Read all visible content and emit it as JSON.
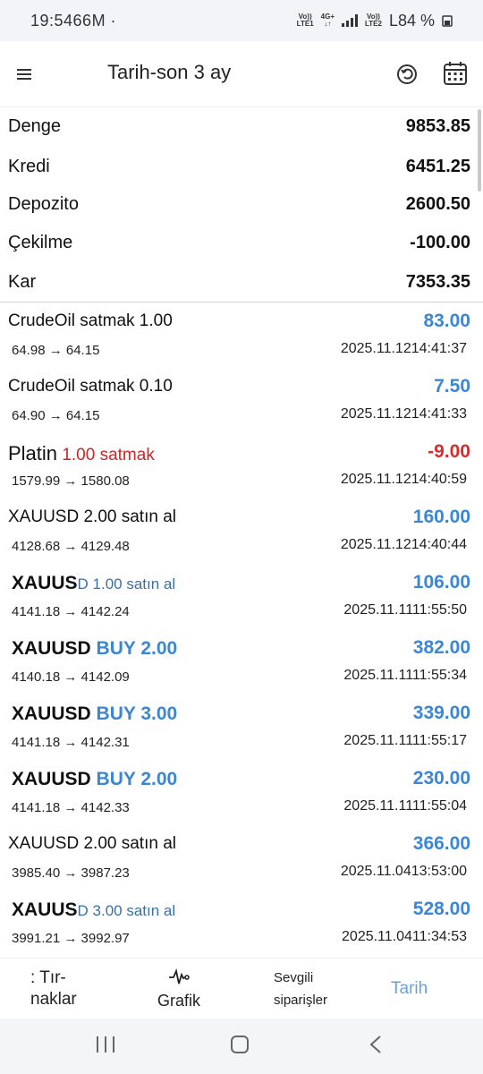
{
  "status_bar": {
    "time": "19:5466M ·",
    "net1_top": "Vo))",
    "net1_bottom": "LTE1",
    "net_mid_top": "4G+",
    "net_mid_bottom": "↓↑",
    "net2_top": "Vo))",
    "net2_bottom": "LTE2",
    "battery": "L84 %"
  },
  "app_bar": {
    "title": "Tarih-son 3 ay"
  },
  "summary": [
    {
      "label": "Denge",
      "value": "9853.85"
    },
    {
      "label": "Kredi",
      "value": "6451.25"
    },
    {
      "label": "Depozito",
      "value": "2600.50"
    },
    {
      "label": "Çekilme",
      "value": "-100.00"
    },
    {
      "label": "Kar",
      "value": "7353.35"
    }
  ],
  "trades": [
    {
      "symbol": "CrudeOil",
      "action": "satmak 1.00",
      "profit": "83.00",
      "prices": "64.98 → 64.15",
      "time": "2025.11.1214:41:37"
    },
    {
      "symbol": "CrudeOil",
      "action": "satmak 0.10",
      "profit": "7.50",
      "prices": "64.90 → 64.15",
      "time": "2025.11.1214:41:33"
    },
    {
      "symbol": "Platin",
      "action": "1.00 satmak",
      "profit": "-9.00",
      "prices": "1579.99 → 1580.08",
      "time": "2025.11.1214:40:59"
    },
    {
      "symbol": "XAUUSD",
      "action": "2.00 satın al",
      "profit": "160.00",
      "prices": "4128.68 → 4129.48",
      "time": "2025.11.1214:40:44"
    },
    {
      "symbol": "XAUUS",
      "action": "D 1.00 satın al",
      "profit": "106.00",
      "prices": "4141.18 → 4142.24",
      "time": "2025.11.1111:55:50"
    },
    {
      "symbol": "XAUUSD",
      "action": "BUY 2.00",
      "profit": "382.00",
      "prices": "4140.18 → 4142.09",
      "time": "2025.11.1111:55:34"
    },
    {
      "symbol": "XAUUSD",
      "action": "BUY 3.00",
      "profit": "339.00",
      "prices": "4141.18 → 4142.31",
      "time": "2025.11.1111:55:17"
    },
    {
      "symbol": "XAUUSD",
      "action": "BUY 2.00",
      "profit": "230.00",
      "prices": "4141.18 → 4142.33",
      "time": "2025.11.1111:55:04"
    },
    {
      "symbol": "XAUUSD",
      "action": "2.00 satın al",
      "profit": "366.00",
      "prices": "3985.40 → 3987.23",
      "time": "2025.11.0413:53:00"
    },
    {
      "symbol": "XAUUS",
      "action": "D 3.00 satın al",
      "profit": "528.00",
      "prices": "3991.21 → 3992.97",
      "time": "2025.11.0411:34:53"
    }
  ],
  "bottom_nav": {
    "quotes_line1": ": Tır-",
    "quotes_line2": "naklar",
    "chart": "Grafik",
    "fav_line1": "Sevgili",
    "fav_line2": "siparişler",
    "history": "Tarih"
  },
  "colors": {
    "profit_positive": "#3b87d4",
    "profit_negative": "#d32f2f",
    "active_tab": "#6aa3d8"
  },
  "icons": {
    "menu": "hamburger-menu-icon",
    "refresh": "refresh-icon",
    "calendar": "calendar-icon",
    "chart": "pulse-chart-icon",
    "recents": "recents-icon",
    "home": "home-icon",
    "back": "back-icon"
  }
}
